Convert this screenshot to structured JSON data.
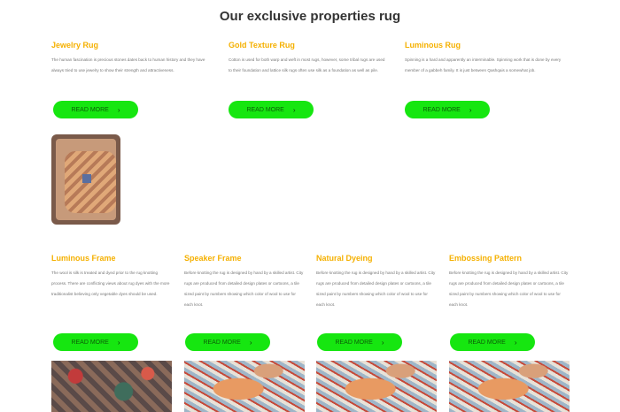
{
  "section": {
    "title": "Our exclusive properties rug"
  },
  "top_cards": [
    {
      "title": "Jewelry Rug",
      "text": "The human fascination is precious stones dates back to human history and they have always tried to use jewelry to show their strength and attractiveness.",
      "button": "READ MORE"
    },
    {
      "title": "Gold Texture Rug",
      "text": "Cotton is used for both warp and weft in most rugs, however, some tribal rugs are used to their foundation and lattice silk rugs often use silk as a foundation as well as pile.",
      "button": "READ MORE"
    },
    {
      "title": "Luminous Rug",
      "text": "Spinning is a hard and apparently an interminable. Spinning work that is done by every member of a gabbeh family. It is just between Qashqais a somewhat job.",
      "button": "READ MORE"
    }
  ],
  "bottom_cards": [
    {
      "title": "Luminous Frame",
      "text": "The wool is silk is treated and dyed prior to the rug knotting process. There are conflicting views about rug dyes with the more traditionalist believing only vegetable dyes should be used.",
      "button": "READ MORE"
    },
    {
      "title": "Speaker Frame",
      "text": "Before knotting the rug is designed by hand by a skilled artist. City rugs are produced from detailed design plates or cartoons, a tile sized paint by numbers showing which color of wool to use for each knot.",
      "button": "READ MORE"
    },
    {
      "title": "Natural Dyeing",
      "text": "Before knotting the rug is designed by hand by a skilled artist. City rugs are produced from detailed design plates or cartoons, a tile sized paint by numbers showing which color of wool to use for each knot.",
      "button": "READ MORE"
    },
    {
      "title": "Embossing Pattern",
      "text": "Before knotting the rug is designed by hand by a skilled artist. City rugs are produced from detailed design plates or cartoons, a tile sized paint by numbers showing which color of wool to use for each knot.",
      "button": "READ MORE"
    }
  ],
  "colors": {
    "accent_title": "#f5b000",
    "button_bg": "#16e610",
    "button_text": "#0b5e07"
  },
  "icons": {
    "button_arrow": "chevron-right-icon"
  }
}
